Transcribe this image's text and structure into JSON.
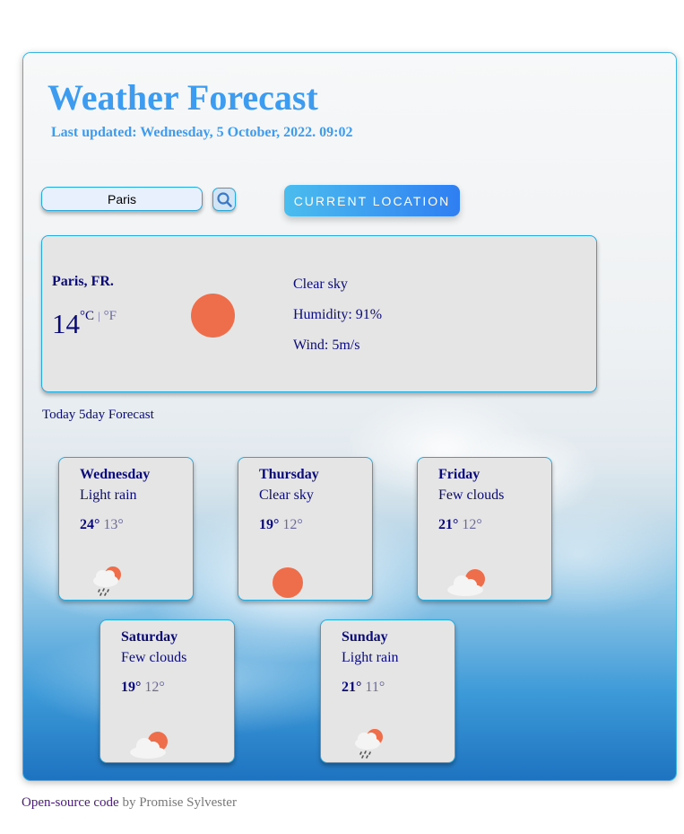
{
  "header": {
    "title": "Weather Forecast",
    "last_updated": "Last updated: Wednesday, 5 October, 2022. 09:02"
  },
  "search": {
    "value": "Paris",
    "icon": "search-icon"
  },
  "current_location_label": "CURRENT LOCATION",
  "current": {
    "city": "Paris, FR.",
    "temp": "14",
    "unit_c": "°C",
    "separator": "|",
    "unit_f": "°F",
    "icon": "sun-icon",
    "condition": "Clear sky",
    "humidity": "Humidity: 91%",
    "wind": "Wind: 5m/s"
  },
  "forecast_title": "Today 5day Forecast",
  "forecast": [
    {
      "day": "Wednesday",
      "desc": "Light rain",
      "high": "24°",
      "low": "13°",
      "icon": "rain-cloud-sun-icon"
    },
    {
      "day": "Thursday",
      "desc": "Clear sky",
      "high": "19°",
      "low": "12°",
      "icon": "sun-icon"
    },
    {
      "day": "Friday",
      "desc": "Few clouds",
      "high": "21°",
      "low": "12°",
      "icon": "cloud-sun-icon"
    },
    {
      "day": "Saturday",
      "desc": "Few clouds",
      "high": "19°",
      "low": "12°",
      "icon": "cloud-sun-icon"
    },
    {
      "day": "Sunday",
      "desc": "Light rain",
      "high": "21°",
      "low": "11°",
      "icon": "rain-cloud-sun-icon"
    }
  ],
  "footer": {
    "link_text": "Open-source code",
    "author_text": "by Promise Sylvester"
  },
  "colors": {
    "accent": "#3d9bf0",
    "text_dark": "#0a0a7a",
    "sun": "#ee6e4b",
    "card_bg": "#e5e5e5",
    "border": "#2aa8d8"
  }
}
